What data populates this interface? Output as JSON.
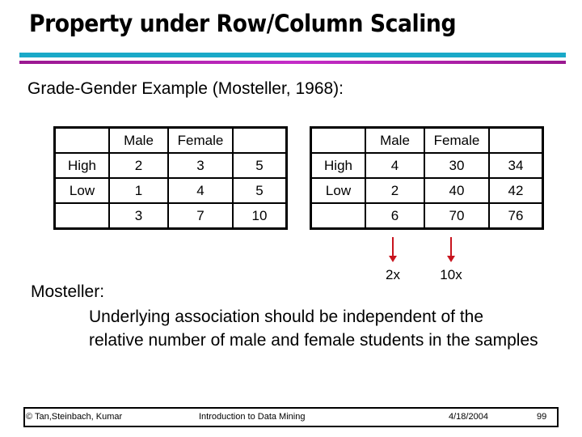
{
  "slide": {
    "title": "Property under Row/Column Scaling",
    "subtitle": "Grade-Gender Example (Mosteller, 1968):",
    "colors": {
      "rule_top": "#1aa9c8",
      "rule_bottom": "#b423b4",
      "arrow": "#c8141e"
    }
  },
  "tables": [
    {
      "header": [
        "",
        "Male",
        "Female",
        ""
      ],
      "rows": [
        [
          "High",
          "2",
          "3",
          "5"
        ],
        [
          "Low",
          "1",
          "4",
          "5"
        ],
        [
          "",
          "3",
          "7",
          "10"
        ]
      ]
    },
    {
      "header": [
        "",
        "Male",
        "Female",
        ""
      ],
      "rows": [
        [
          "High",
          "4",
          "30",
          "34"
        ],
        [
          "Low",
          "2",
          "40",
          "42"
        ],
        [
          "",
          "6",
          "70",
          "76"
        ]
      ]
    }
  ],
  "scaling": {
    "male_label": "2x",
    "female_label": "10x"
  },
  "body": {
    "heading": "Mosteller:",
    "text": "Underlying association should be independent of the relative number of male and female students in the samples"
  },
  "footer": {
    "copyright": "© Tan,Steinbach, Kumar",
    "course": "Introduction to Data Mining",
    "date": "4/18/2004",
    "page": "99"
  }
}
